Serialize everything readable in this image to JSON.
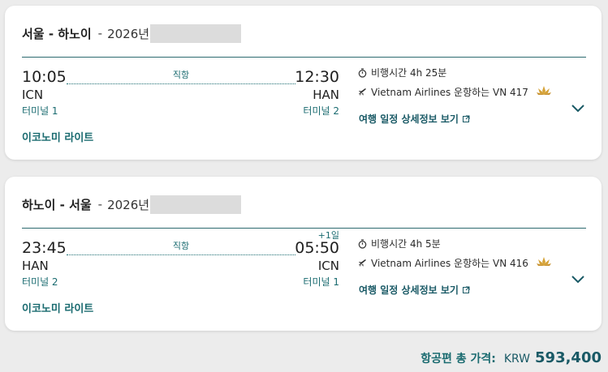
{
  "flights": [
    {
      "route": "서울 - 하노이",
      "separator": "-",
      "date_prefix": "2026년",
      "departure": {
        "time": "10:05",
        "airport": "ICN",
        "terminal": "터미널 1"
      },
      "arrival": {
        "time": "12:30",
        "airport": "HAN",
        "terminal": "터미널 2",
        "day_offset": ""
      },
      "stops_label": "직항",
      "duration": "비행시간 4h 25분",
      "operated_by": "Vietnam Airlines 운항하는 VN 417",
      "details_link": "여행 일정 상세정보 보기",
      "cabin": "이코노미 라이트"
    },
    {
      "route": "하노이 - 서울",
      "separator": "-",
      "date_prefix": "2026년",
      "departure": {
        "time": "23:45",
        "airport": "HAN",
        "terminal": "터미널 2"
      },
      "arrival": {
        "time": "05:50",
        "airport": "ICN",
        "terminal": "터미널 1",
        "day_offset": "+1일"
      },
      "stops_label": "직항",
      "duration": "비행시간 4h 5분",
      "operated_by": "Vietnam Airlines 운항하는 VN 416",
      "details_link": "여행 일정 상세정보 보기",
      "cabin": "이코노미 라이트"
    }
  ],
  "total": {
    "label": "항공편 총 가격:",
    "currency": "KRW",
    "amount": "593,400"
  },
  "colors": {
    "accent": "#1a6b70",
    "lotus": "#d6a33a",
    "background": "#ececec"
  },
  "icons": [
    "stopwatch-icon",
    "plane-icon",
    "lotus-logo-icon",
    "external-link-icon",
    "chevron-down-icon"
  ]
}
